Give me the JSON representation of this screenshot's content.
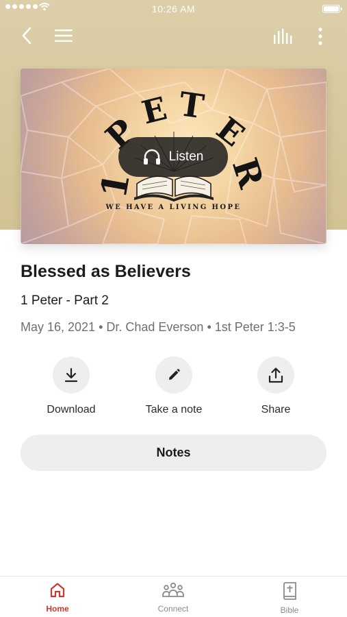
{
  "status_bar": {
    "time": "10:26 AM"
  },
  "header": {
    "back_icon": "chevron-left-icon",
    "menu_icon": "hamburger-icon",
    "audio_icon": "equalizer-icon",
    "more_icon": "vertical-dots-icon"
  },
  "hero": {
    "artwork_title": "1 PETER",
    "artwork_letters": [
      "1",
      "P",
      "E",
      "T",
      "E",
      "R"
    ],
    "tagline": "WE HAVE A LIVING HOPE",
    "listen_label": "Listen"
  },
  "sermon": {
    "title": "Blessed as Believers",
    "series": "1 Peter - Part 2",
    "meta": "May 16, 2021 • Dr. Chad Everson • 1st Peter 1:3-5"
  },
  "actions": [
    {
      "label": "Download",
      "icon": "download-icon"
    },
    {
      "label": "Take a note",
      "icon": "pencil-icon"
    },
    {
      "label": "Share",
      "icon": "share-icon"
    }
  ],
  "notes_button": {
    "label": "Notes"
  },
  "tabs": [
    {
      "label": "Home",
      "icon": "home-icon",
      "active": true
    },
    {
      "label": "Connect",
      "icon": "people-icon",
      "active": false
    },
    {
      "label": "Bible",
      "icon": "bible-icon",
      "active": false
    }
  ],
  "colors": {
    "accent": "#c9392c",
    "header_band": "#d8cba0",
    "button_gray": "#eeeeee"
  }
}
